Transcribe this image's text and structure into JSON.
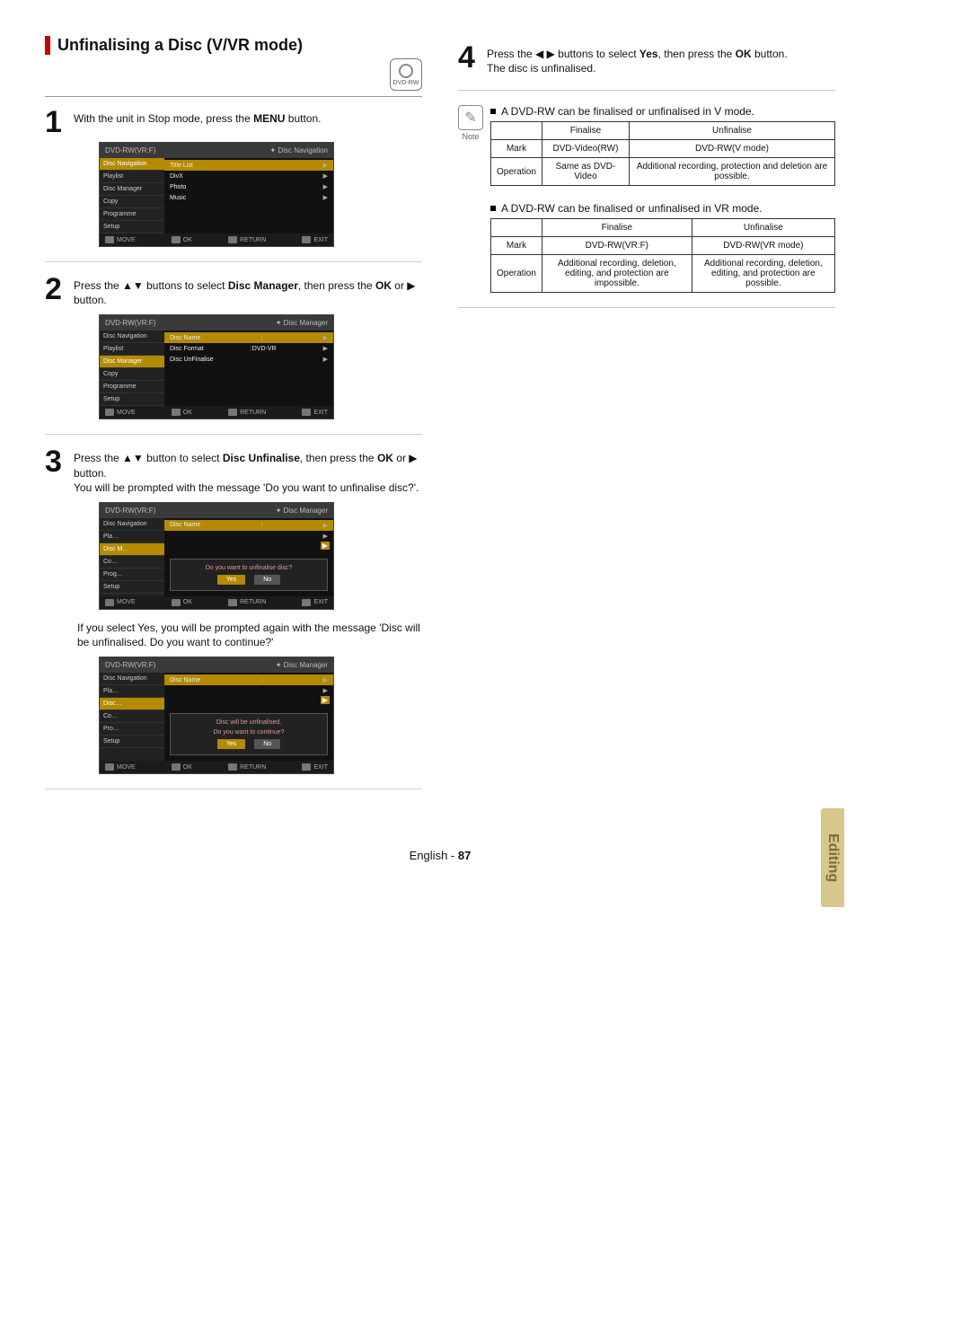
{
  "title": "Unfinalising a Disc (V/VR mode)",
  "disc_badge": "DVD-RW",
  "steps": {
    "s1": {
      "num": "1",
      "pre": "With the unit in Stop mode, press the ",
      "bold": "MENU",
      "post": " button."
    },
    "s2": {
      "num": "2",
      "pre": "Press the ▲▼ buttons to select ",
      "bold": "Disc Manager",
      "post": ", then press the ",
      "bold2": "OK",
      "post2": " or ▶ button."
    },
    "s3": {
      "num": "3",
      "pre": "Press the ▲▼ button to select ",
      "bold": "Disc Unfinalise",
      "post": ", then press the ",
      "bold2": "OK",
      "post2": " or ▶ button.",
      "extra": "You will be prompted with the message 'Do you want to unfinalise disc?'.",
      "after": "If you select Yes, you will be prompted again with the message 'Disc will be unfinalised. Do you want to continue?'"
    },
    "s4": {
      "num": "4",
      "pre": "Press the ◀ ▶ buttons to select ",
      "bold": "Yes",
      "post": ", then press the ",
      "bold2": "OK",
      "post2": " button.",
      "extra": "The disc is unfinalised."
    }
  },
  "osd": {
    "header_left": "DVD-RW(VR:F)",
    "crumb_nav": "✦ Disc Navigation",
    "crumb_mgr": "✦ Disc Manager",
    "footer": {
      "move": "MOVE",
      "ok": "OK",
      "return": "RETURN",
      "exit": "EXIT"
    },
    "nav_items": [
      "Disc Navigation",
      "Playlist",
      "Disc Manager",
      "Copy",
      "Programme",
      "Setup"
    ],
    "menu1": [
      "Title List",
      "DivX",
      "Photo",
      "Music"
    ],
    "menu2": [
      {
        "l": "Disc Name",
        "v": ":"
      },
      {
        "l": "Disc Format",
        "v": ":DVD-VR"
      },
      {
        "l": "Disc UnFinalise",
        "v": ""
      }
    ],
    "menu3_top": {
      "l": "Disc Name",
      "v": ":"
    },
    "dlg1": {
      "line1": "Do you want to unfinalise disc?",
      "yes": "Yes",
      "no": "No"
    },
    "dlg2": {
      "line1": "Disc will be unfinalised.",
      "line2": "Do you want to continue?",
      "yes": "Yes",
      "no": "No"
    }
  },
  "note": {
    "label": "Note",
    "b1": "A DVD-RW can be finalised or unfinalised in V mode.",
    "b2": "A DVD-RW can be finalised or unfinalised in VR mode."
  },
  "table1": {
    "h_fin": "Finalise",
    "h_unf": "Unfinalise",
    "r1_h": "Mark",
    "r1_f": "DVD-Video(RW)",
    "r1_u": "DVD-RW(V mode)",
    "r2_h": "Operation",
    "r2_f": "Same as DVD-Video",
    "r2_u": "Additional recording, protection and deletion are possible."
  },
  "table2": {
    "h_fin": "Finalise",
    "h_unf": "Unfinalise",
    "r1_h": "Mark",
    "r1_f": "DVD-RW(VR:F)",
    "r1_u": "DVD-RW(VR mode)",
    "r2_h": "Operation",
    "r2_f": "Additional recording, deletion, editing, and protection are impossible.",
    "r2_u": "Additional recording, deletion, editing, and protection are possible."
  },
  "sidetab": "Editing",
  "footer": {
    "lang": "English",
    "dash": " - ",
    "page": "87"
  }
}
